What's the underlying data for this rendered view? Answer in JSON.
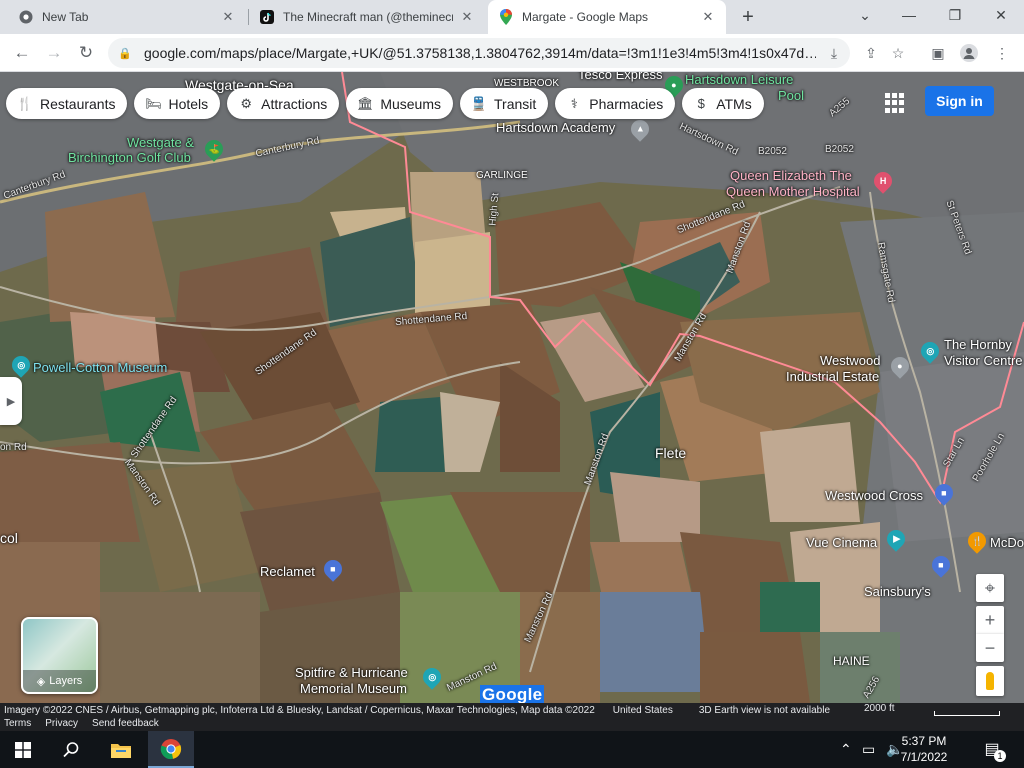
{
  "browser": {
    "tabs": [
      {
        "title": "New Tab",
        "icon": "chrome-icon"
      },
      {
        "title": "The Minecraft man (@theminecra…",
        "icon": "tiktok-icon"
      },
      {
        "title": "Margate - Google Maps",
        "icon": "google-maps-icon",
        "active": true
      }
    ],
    "new_tab_label": "+",
    "window_controls": {
      "dropdown": "⌄",
      "minimize": "—",
      "restore": "❐",
      "close": "✕"
    },
    "nav": {
      "back": "←",
      "forward": "→",
      "reload": "↻"
    },
    "url": "google.com/maps/place/Margate,+UK/@51.3758138,1.3804762,3914m/data=!3m1!1e3!4m5!3m4!1s0x47d…"
  },
  "maps": {
    "category_chips": [
      {
        "label": "Restaurants",
        "icon": "🍴"
      },
      {
        "label": "Hotels",
        "icon": "🛏"
      },
      {
        "label": "Attractions",
        "icon": "⚙"
      },
      {
        "label": "Museums",
        "icon": "🏛"
      },
      {
        "label": "Transit",
        "icon": "🚆"
      },
      {
        "label": "Pharmacies",
        "icon": "⚕"
      },
      {
        "label": "ATMs",
        "icon": "$"
      }
    ],
    "sign_in": "Sign in",
    "layers_label": "Layers",
    "google_logo": "Google",
    "place_labels": {
      "westgate": "Westgate-on-Sea",
      "westbrook": "WESTBROOK",
      "tesco": "Tesco Express",
      "hartsdown_leisure": "Hartsdown Leisure",
      "pool": "Pool",
      "westgate_golf_1": "Westgate &",
      "westgate_golf_2": "Birchington Golf Club",
      "hartsdown_academy": "Hartsdown Academy",
      "garlinge": "GARLINGE",
      "qeqm_1": "Queen Elizabeth The",
      "qeqm_2": "Queen Mother Hospital",
      "hornby_1": "The Hornby",
      "hornby_2": "Visitor Centre",
      "westwood_ind_1": "Westwood",
      "westwood_ind_2": "Industrial Estate",
      "powell_cotton": "Powell-Cotton Museum",
      "flete": "Flete",
      "westwood_cross": "Westwood Cross",
      "vue": "Vue Cinema",
      "mcd": "McDo",
      "reclamet": "Reclamet",
      "sainsburys": "Sainsbury's",
      "haine": "HAINE",
      "spitfire_1": "Spitfire & Hurricane",
      "spitfire_2": "Memorial Museum",
      "col": "col"
    },
    "road_labels": {
      "canterbury_rd_1": "Canterbury Rd",
      "canterbury_rd_2": "Canterbury Rd",
      "hartsdown_rd": "Hartsdown Rd",
      "b2052_a": "B2052",
      "b2052_b": "B2052",
      "a255": "A255",
      "high_st": "High St",
      "shottendane_1": "Shottendane Rd",
      "shottendane_2": "Shottendane Rd",
      "shottendane_3": "Shottendane Rd",
      "shottendane_4": "Shottendane Rd",
      "manston_1": "Manston Rd",
      "manston_2": "Manston Rd",
      "manston_3": "Manston Rd",
      "manston_4": "Manston Rd",
      "manston_5": "Manston Rd",
      "manston_6": "Manston Rd",
      "ramsgate_rd": "Ramsgate Rd",
      "st_peters": "St Peters Rd",
      "poorhole": "Poorhole Ln",
      "star_ln": "Star Ln",
      "on_rd": "on Rd",
      "a256": "A256"
    },
    "footer": {
      "imagery": "Imagery ©2022 CNES / Airbus, Getmapping plc, Infoterra Ltd & Bluesky, Landsat / Copernicus, Maxar Technologies, Map data ©2022",
      "country": "United States",
      "earth_note": "3D Earth view is not available",
      "scale": "2000 ft",
      "terms": "Terms",
      "privacy": "Privacy",
      "feedback": "Send feedback"
    }
  },
  "taskbar": {
    "time": "5:37 PM",
    "date": "7/1/2022",
    "notification_count": "1"
  },
  "colors": {
    "boundary": "#e8838f",
    "signin": "#1a73e8",
    "taskbar": "#101418"
  }
}
